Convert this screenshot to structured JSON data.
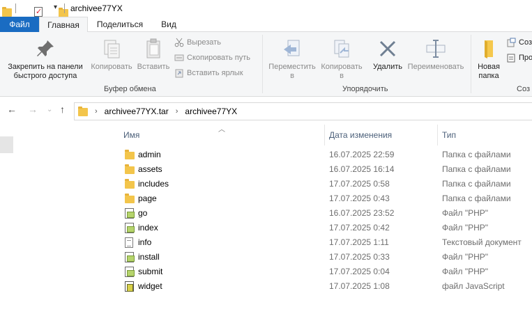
{
  "window": {
    "title": "archivee77YX"
  },
  "ribbon_tabs": [
    {
      "label": "Файл"
    },
    {
      "label": "Главная"
    },
    {
      "label": "Поделиться"
    },
    {
      "label": "Вид"
    }
  ],
  "ribbon": {
    "pin": "Закрепить на панели\nбыстрого доступа",
    "copy": "Копировать",
    "paste": "Вставить",
    "cut": "Вырезать",
    "copy_path": "Скопировать путь",
    "paste_shortcut": "Вставить ярлык",
    "clipboard_group": "Буфер обмена",
    "move_to": "Переместить\nв",
    "copy_to": "Копировать\nв",
    "delete": "Удалить",
    "rename": "Переименовать",
    "organize_group": "Упорядочить",
    "new_folder": "Новая\nпапка",
    "new_item": "Соз",
    "easy_access": "Про",
    "create_group": "Соз"
  },
  "breadcrumbs": [
    "archivee77YX.tar",
    "archivee77YX"
  ],
  "columns": {
    "name": "Имя",
    "date": "Дата изменения",
    "type": "Тип"
  },
  "files": [
    {
      "name": "admin",
      "date": "16.07.2025 22:59",
      "type": "Папка с файлами",
      "icon": "folder-icon"
    },
    {
      "name": "assets",
      "date": "16.07.2025 16:14",
      "type": "Папка с файлами",
      "icon": "folder-icon"
    },
    {
      "name": "includes",
      "date": "17.07.2025 0:58",
      "type": "Папка с файлами",
      "icon": "folder-icon"
    },
    {
      "name": "page",
      "date": "17.07.2025 0:43",
      "type": "Папка с файлами",
      "icon": "folder-icon"
    },
    {
      "name": "go",
      "date": "16.07.2025 23:52",
      "type": "Файл \"PHP\"",
      "icon": "php-file-icon"
    },
    {
      "name": "index",
      "date": "17.07.2025 0:42",
      "type": "Файл \"PHP\"",
      "icon": "php-file-icon"
    },
    {
      "name": "info",
      "date": "17.07.2025 1:11",
      "type": "Текстовый документ",
      "icon": "text-file-icon"
    },
    {
      "name": "install",
      "date": "17.07.2025 0:33",
      "type": "Файл \"PHP\"",
      "icon": "php-file-icon"
    },
    {
      "name": "submit",
      "date": "17.07.2025 0:04",
      "type": "Файл \"PHP\"",
      "icon": "php-file-icon"
    },
    {
      "name": "widget",
      "date": "17.07.2025 1:08",
      "type": "файл JavaScript",
      "icon": "js-file-icon"
    }
  ]
}
